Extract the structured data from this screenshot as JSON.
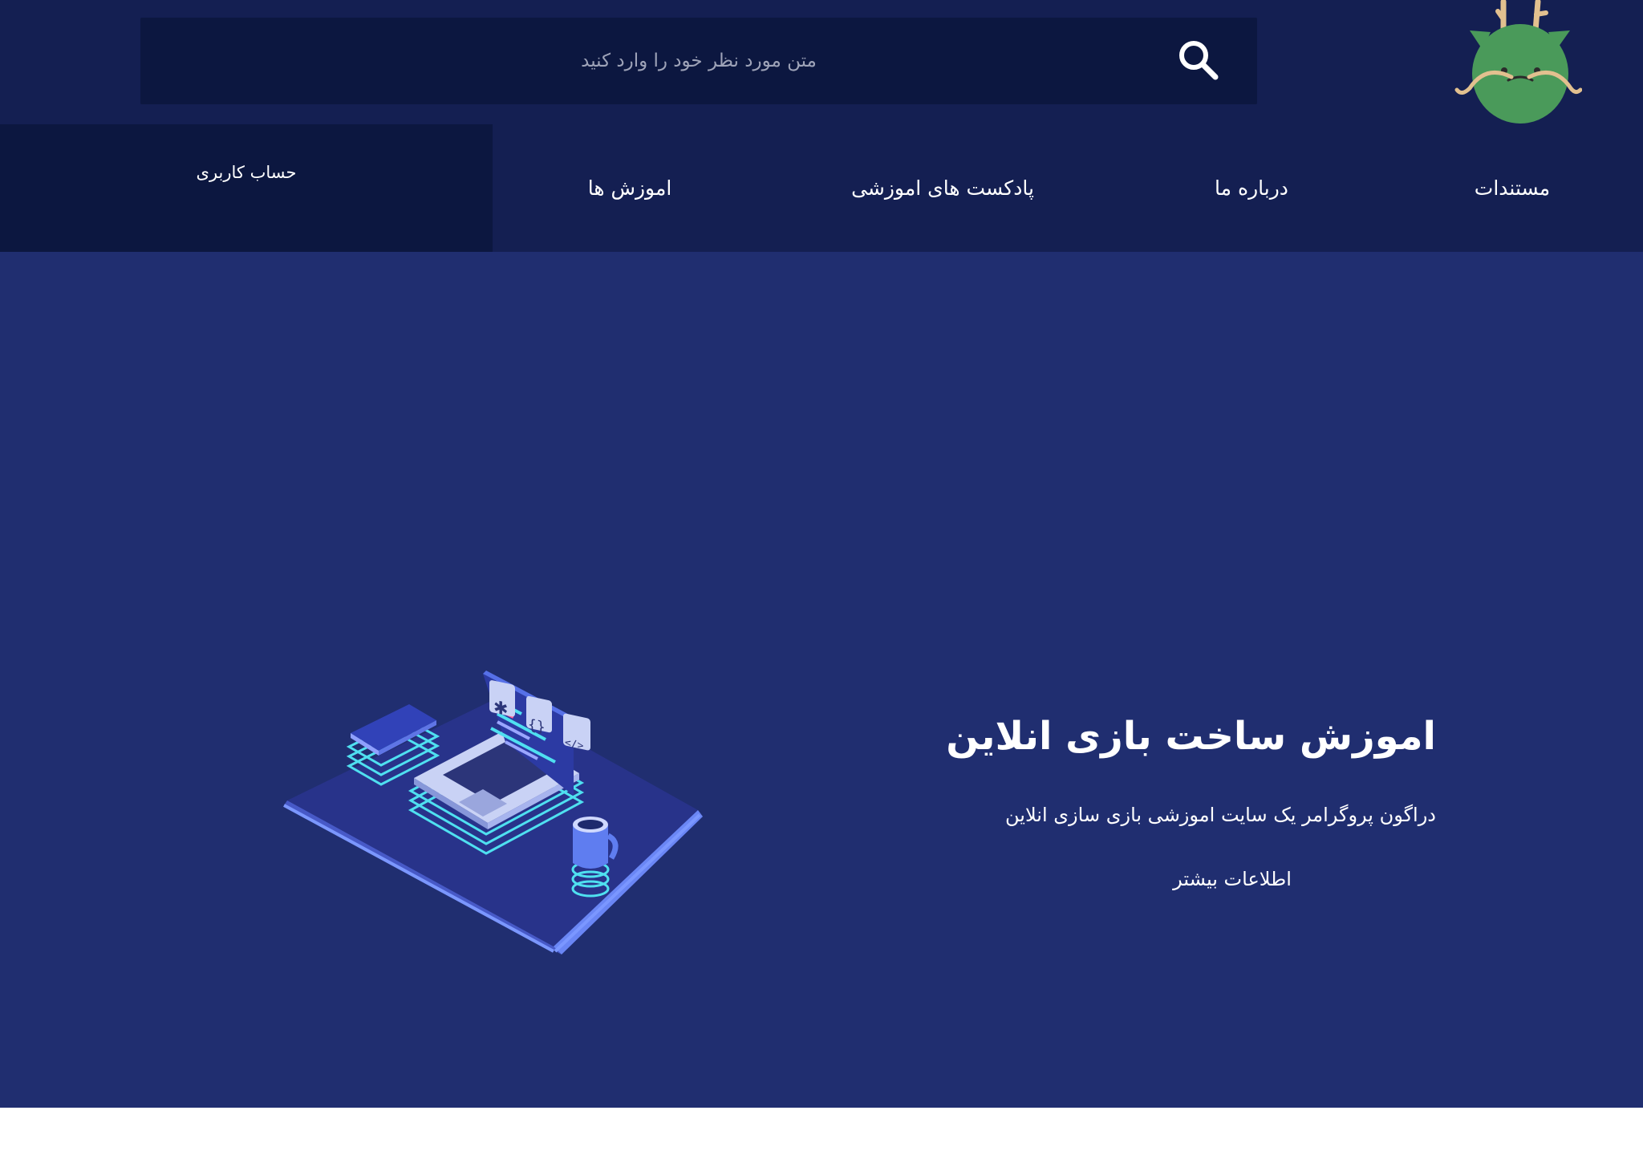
{
  "header": {
    "search": {
      "placeholder": "متن مورد نظر خود را وارد کنید"
    },
    "logo_icon": "dragon-mascot-icon",
    "nav": {
      "docs": "مستندات",
      "about": "درباره ما",
      "podcasts": "پادکست های اموزشی",
      "tutorials": "اموزش ها"
    },
    "account": "حساب کاربری"
  },
  "hero": {
    "title": "اموزش ساخت بازی انلاین",
    "subtitle": "دراگون پروگرامر یک سایت اموزشی بازی سازی انلاین",
    "more": "اطلاعات بیشتر",
    "illustration_icon": "isometric-laptop-workspace-illustration"
  },
  "colors": {
    "header_bg": "#141f52",
    "search_bg": "#0c1740",
    "hero_bg": "#202e70",
    "text": "#ffffff",
    "accent": "#5b7cfa",
    "logo_green": "#4a9a5a"
  }
}
